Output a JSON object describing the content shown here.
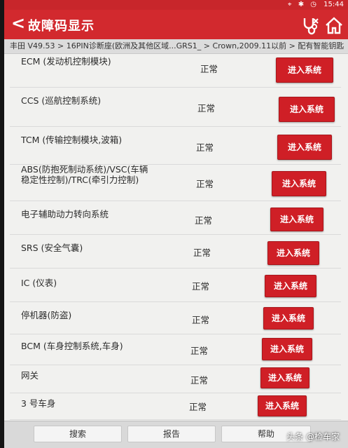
{
  "status_bar": {
    "time": "15:44",
    "icons": [
      "location-icon",
      "bluetooth-icon",
      "alarm-icon"
    ]
  },
  "header": {
    "title": "故障码显示",
    "back_glyph": "<"
  },
  "breadcrumb": "丰田 V49.53 > 16PIN诊断座(欧洲及其他区域...GRS1_ > Crown,2009.11以前 > 配有智能钥匙",
  "systems": [
    {
      "name": "ECM (发动机控制模块)",
      "status": "正常",
      "button": "进入系统"
    },
    {
      "name": "CCS (巡航控制系统)",
      "status": "正常",
      "button": "进入系统"
    },
    {
      "name": "TCM (传输控制模块,波箱)",
      "status": "正常",
      "button": "进入系统"
    },
    {
      "name": "ABS(防抱死制动系统)/VSC(车辆稳定性控制)/TRC(牵引力控制)",
      "status": "正常",
      "button": "进入系统"
    },
    {
      "name": "电子辅助动力转向系统",
      "status": "正常",
      "button": "进入系统"
    },
    {
      "name": "SRS (安全气囊)",
      "status": "正常",
      "button": "进入系统"
    },
    {
      "name": "IC (仪表)",
      "status": "正常",
      "button": "进入系统"
    },
    {
      "name": "停机器(防盗)",
      "status": "正常",
      "button": "进入系统"
    },
    {
      "name": "BCM (车身控制系统,车身)",
      "status": "正常",
      "button": "进入系统"
    },
    {
      "name": "网关",
      "status": "正常",
      "button": "进入系统"
    },
    {
      "name": "3 号车身",
      "status": "正常",
      "button": "进入系统"
    }
  ],
  "toolbar": {
    "search": "搜索",
    "report": "报告",
    "help": "帮助"
  },
  "watermark": "头条 @检车家",
  "colors": {
    "accent": "#d2292e",
    "button": "#cf1f26",
    "background": "#f1f1ef"
  }
}
